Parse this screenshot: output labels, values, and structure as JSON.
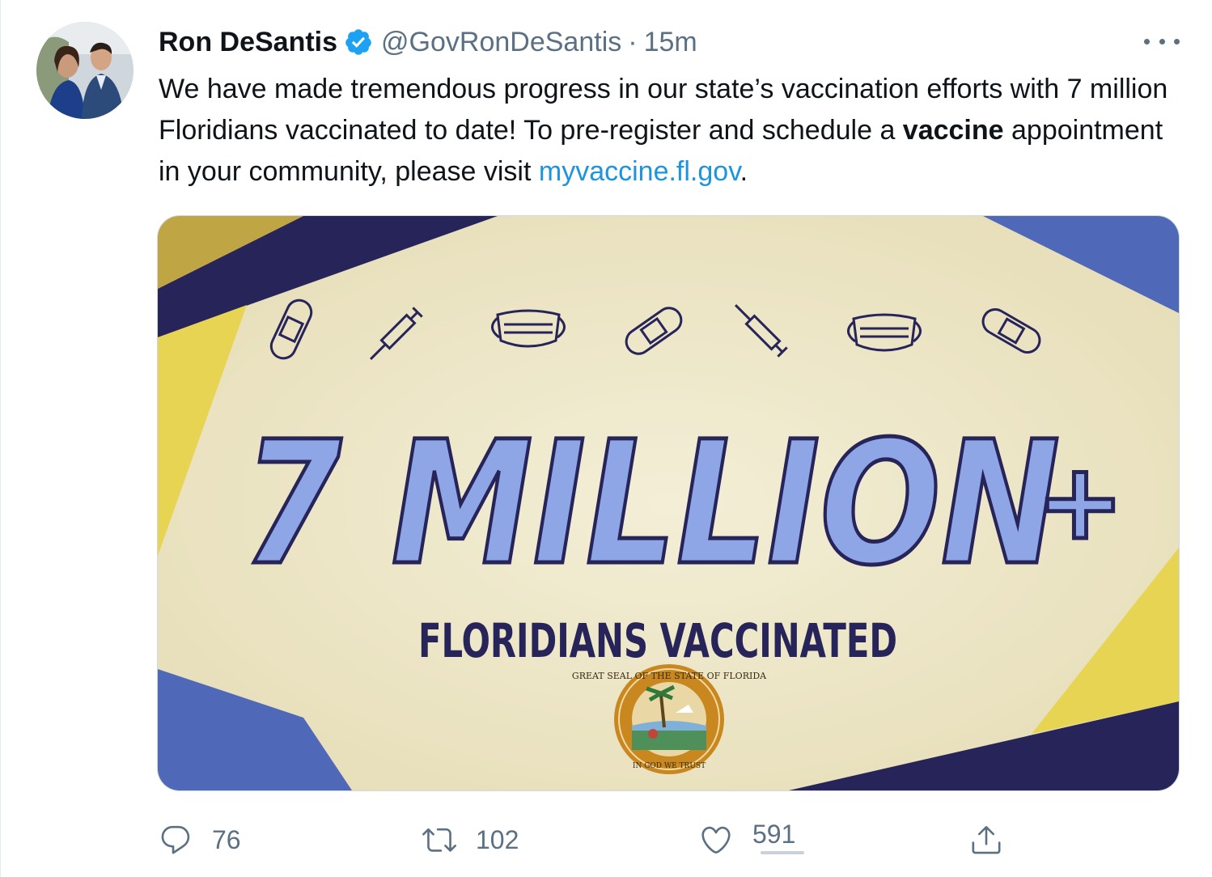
{
  "tweet": {
    "display_name": "Ron DeSantis",
    "handle": "@GovRonDeSantis",
    "separator": "·",
    "time": "15m",
    "verified": true,
    "avatar_icon": "profile-photo",
    "more_icon": "more-dots-icon",
    "text": {
      "line_part1": "We have made tremendous progress in our state’s vaccination efforts with 7 million Floridians vaccinated to date! To pre-register and schedule a ",
      "bold_word": "vaccine",
      "line_part2": " appointment in your community, please visit ",
      "link_text": "myvaccine.fl.gov",
      "end": "."
    }
  },
  "media": {
    "headline": "7 MILLION",
    "plus": "+",
    "subhead": "FLORIDIANS VACCINATED",
    "seal_top_text": "GREAT SEAL OF THE STATE OF FLORIDA",
    "seal_bottom_text": "IN GOD WE TRUST",
    "icons": [
      "bandage-icon",
      "syringe-icon",
      "mask-icon",
      "bandage-icon",
      "syringe-icon",
      "mask-icon",
      "bandage-icon"
    ],
    "colors": {
      "background": "#ede6c8",
      "navy": "#27245a",
      "blue": "#4f68b8",
      "yellow": "#e8d453",
      "headline_fill": "#8ea6e6"
    }
  },
  "actions": {
    "reply_count": "76",
    "retweet_count": "102",
    "like_count": "591",
    "icons": [
      "reply-icon",
      "retweet-icon",
      "like-icon",
      "share-icon"
    ]
  },
  "colors": {
    "text": "#0f1419",
    "secondary": "#5b7083",
    "link": "#1b95e0",
    "verified": "#1da1f2"
  }
}
